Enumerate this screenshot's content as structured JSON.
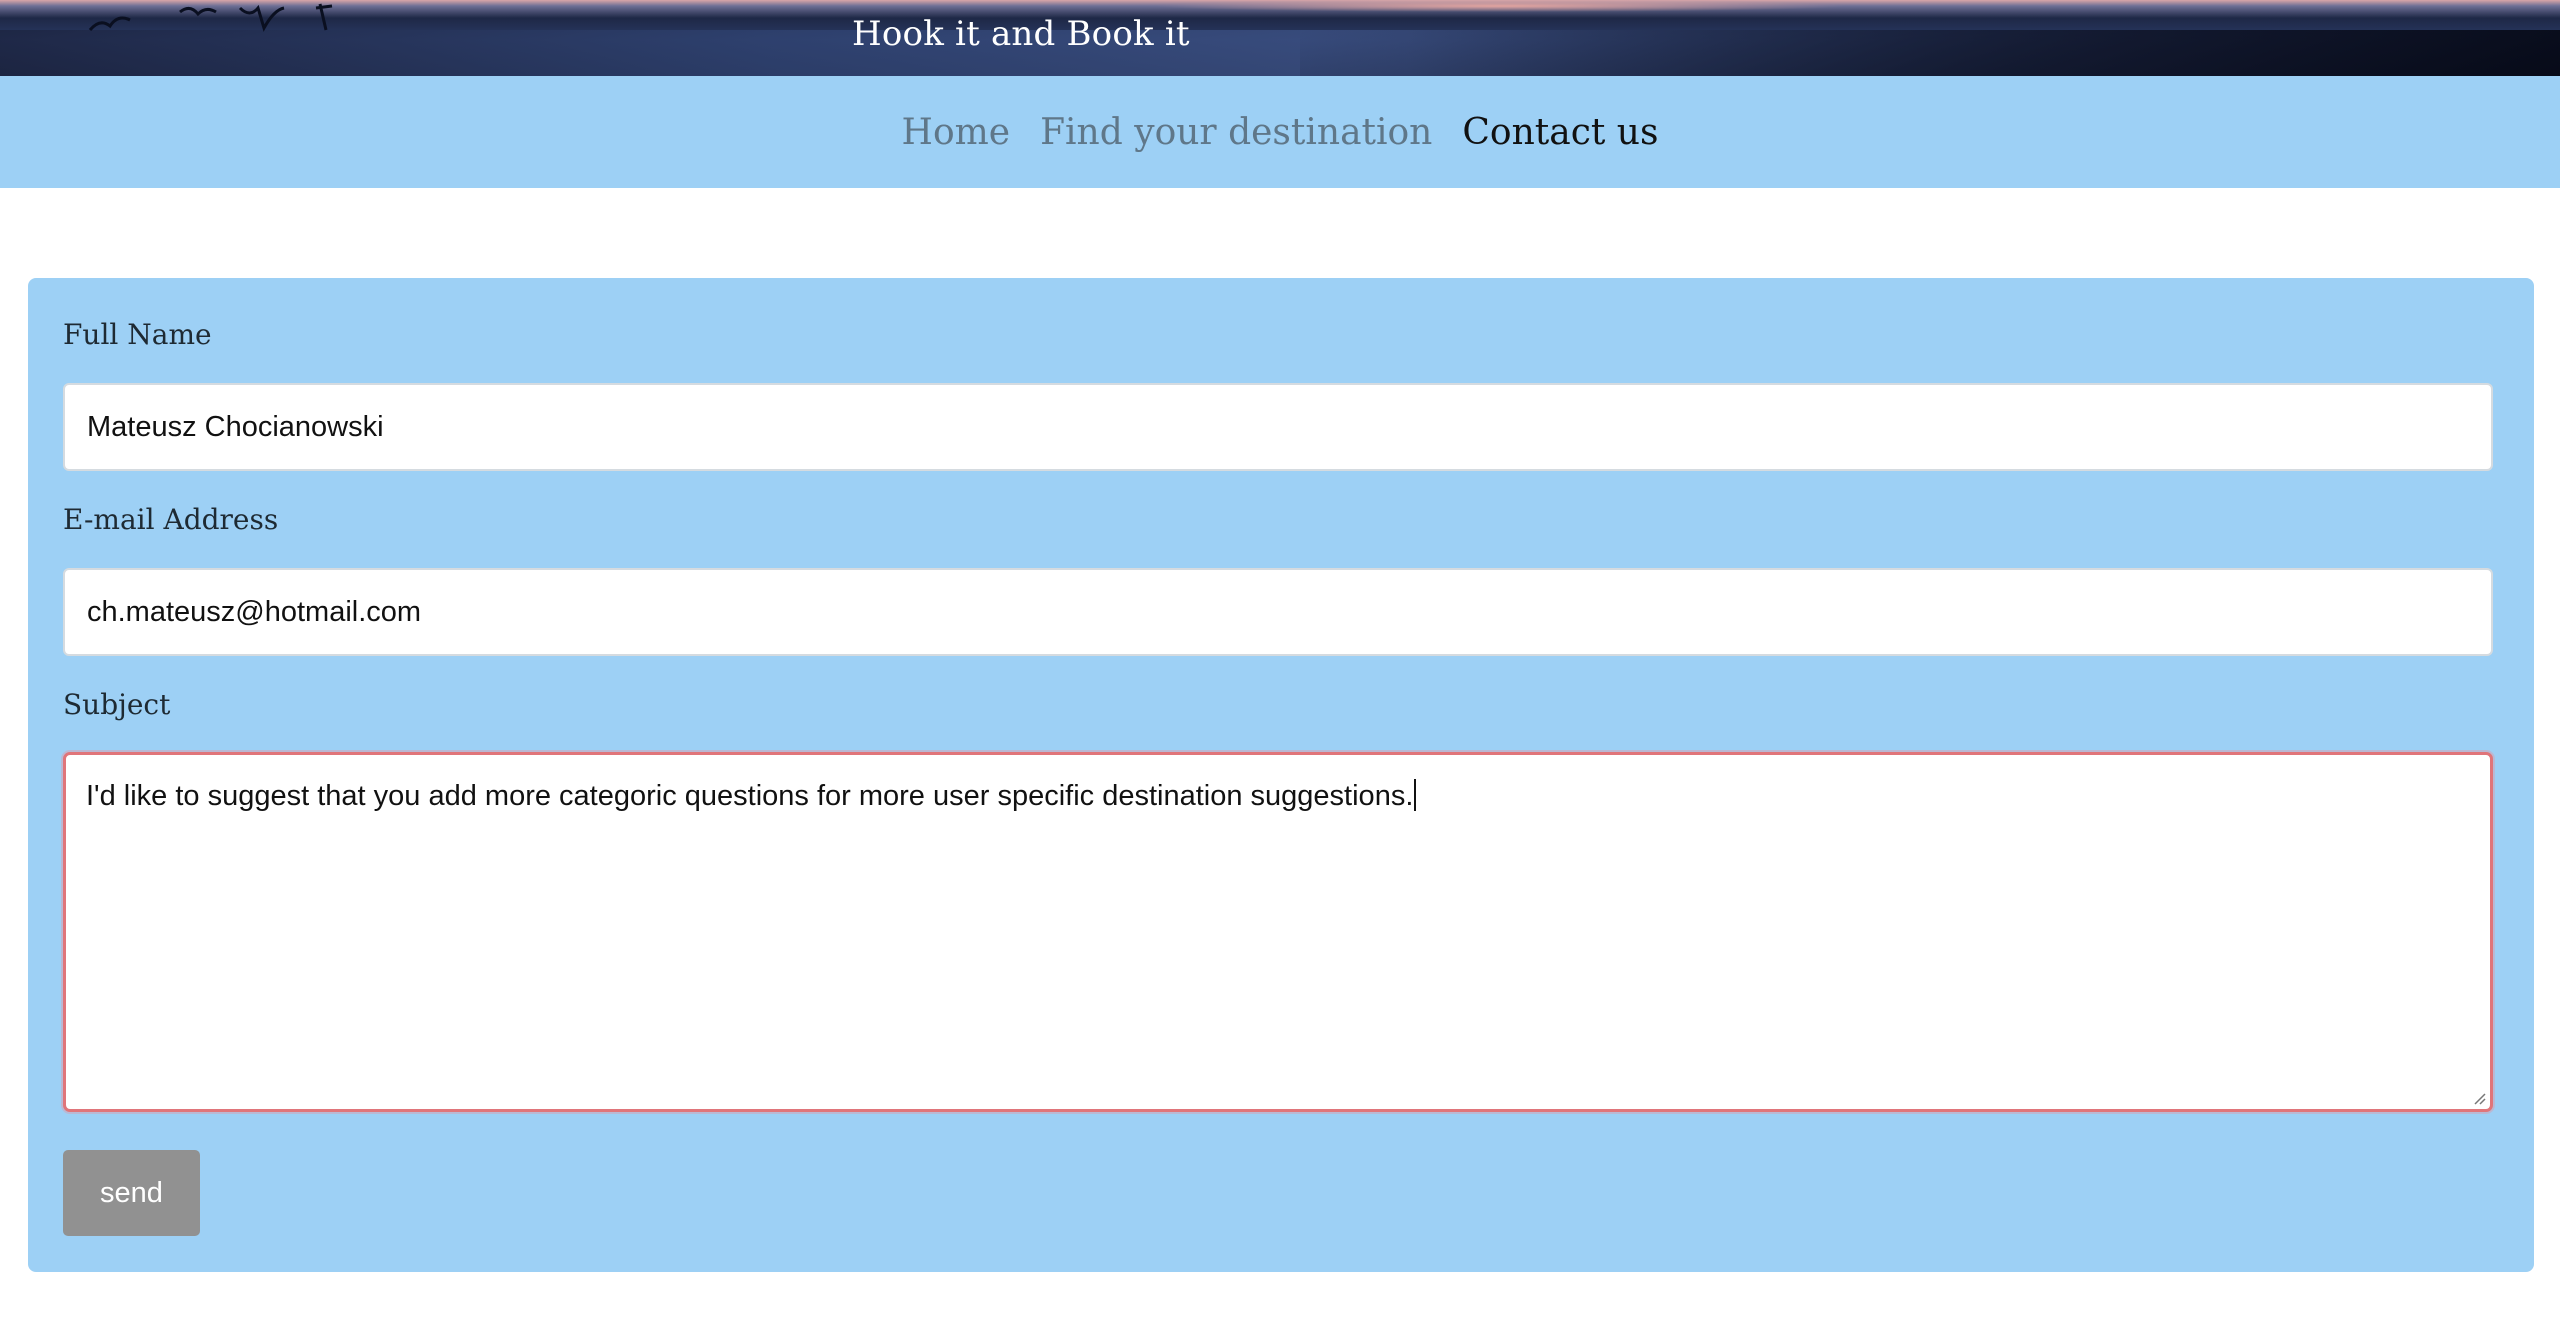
{
  "banner": {
    "title": "Hook it and Book it"
  },
  "nav": {
    "items": [
      {
        "label": "Home",
        "active": false
      },
      {
        "label": "Find your destination",
        "active": false
      },
      {
        "label": "Contact us",
        "active": true
      }
    ]
  },
  "form": {
    "full_name": {
      "label": "Full Name",
      "value": "Mateusz Chocianowski"
    },
    "email": {
      "label": "E-mail Address",
      "value": "ch.mateusz@hotmail.com"
    },
    "subject": {
      "label": "Subject",
      "value": "I'd like to suggest that you add more categoric questions for more user specific destination suggestions."
    },
    "send_label": "send"
  },
  "colors": {
    "nav_background": "#9dd0f5",
    "panel_background": "#9dd0f5",
    "nav_inactive": "#5f7789",
    "nav_active": "#111111",
    "send_button": "#919191",
    "focus_border": "#e0757a"
  }
}
